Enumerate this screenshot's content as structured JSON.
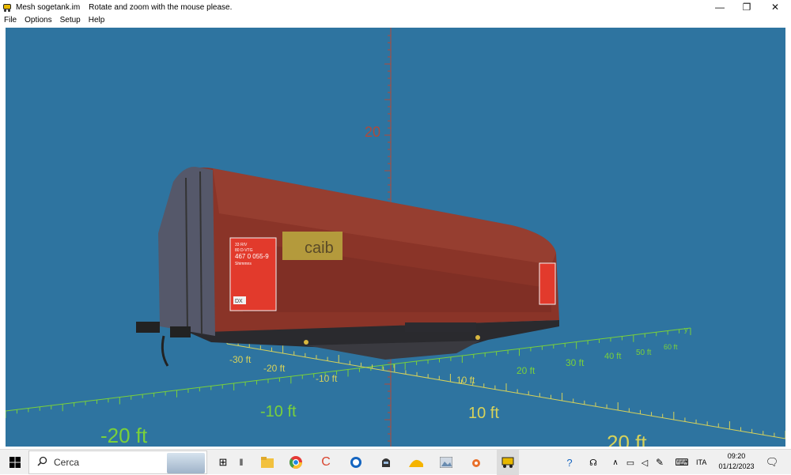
{
  "window": {
    "title": "Mesh sogetank.im",
    "hint": "Rotate and zoom with the mouse please.",
    "controls": {
      "minimize": "—",
      "restore": "❐",
      "close": "✕"
    }
  },
  "menu": {
    "items": [
      "File",
      "Options",
      "Setup",
      "Help"
    ]
  },
  "viewport": {
    "background": "#2e74a0",
    "axis_labels": {
      "vertical": "20",
      "y_axis": "y",
      "ticks_back": [
        "-30 ft",
        "-20 ft",
        "-10 ft",
        "10 ft",
        "20 ft",
        "30 ft",
        "40 ft",
        "50 ft",
        "60 ft"
      ],
      "ticks_front": [
        "-20 ft",
        "-10 ft",
        "10 ft",
        "20 ft"
      ]
    },
    "wagon": {
      "panel_text": [
        "33 RIV",
        "80 D-VTG",
        "467 0 055-9",
        "Shimmns"
      ],
      "brand": "caib",
      "plate": "DX"
    }
  },
  "taskbar": {
    "search_placeholder": "Cerca",
    "language": "ITA",
    "time": "09:20",
    "date": "01/12/2023"
  },
  "colors": {
    "axis_red": "#b04a3a",
    "axis_green": "#7ad13a",
    "axis_yellow": "#d7d25a",
    "wagon_red": "#8a3428"
  }
}
